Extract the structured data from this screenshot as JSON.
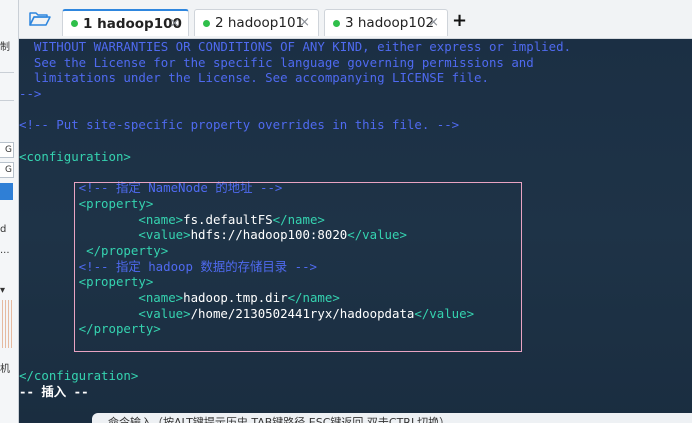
{
  "app": {
    "accent": "#2e86de",
    "terminal_bg": "#1b2f44"
  },
  "left_panel": {
    "frag_top": "制",
    "frag_g1": "G",
    "frag_g2": "G",
    "frag_d": "d",
    "frag_dots": "...",
    "frag_arrow": "▾",
    "frag_ji": "机"
  },
  "toolbar": {
    "folder_icon": "folder-open-icon"
  },
  "tabs": [
    {
      "label": "1  hadoop100",
      "status_color": "#2fbf4a",
      "close": "×",
      "active": true
    },
    {
      "label": "2  hadoop101",
      "status_color": "#2fbf4a",
      "close": "×",
      "active": false
    },
    {
      "label": "3  hadoop102",
      "status_color": "#2fbf4a",
      "close": "×",
      "active": false
    }
  ],
  "new_tab_label": "+",
  "terminal": {
    "lines": [
      [
        {
          "c": "c-blue",
          "t": "  WITHOUT WARRANTIES OR CONDITIONS OF ANY KIND, either express or implied."
        }
      ],
      [
        {
          "c": "c-blue",
          "t": "  See the License for the specific language governing permissions and"
        }
      ],
      [
        {
          "c": "c-blue",
          "t": "  limitations under the License. See accompanying LICENSE file."
        }
      ],
      [
        {
          "c": "c-blue",
          "t": "-->"
        }
      ],
      [],
      [
        {
          "c": "c-blue",
          "t": "<!-- Put site-specific property overrides in this file. -->"
        }
      ],
      [],
      [
        {
          "c": "c-green",
          "t": "<configuration>"
        }
      ],
      [],
      [
        {
          "c": "c-blue",
          "t": "        <!-- 指定 NameNode 的地址 -->"
        }
      ],
      [
        {
          "c": "c-green",
          "t": "        <property>"
        }
      ],
      [
        {
          "c": "c-white",
          "t": "                "
        },
        {
          "c": "c-green",
          "t": "<name>"
        },
        {
          "c": "c-white",
          "t": "fs.defaultFS"
        },
        {
          "c": "c-green",
          "t": "</name>"
        }
      ],
      [
        {
          "c": "c-white",
          "t": "                "
        },
        {
          "c": "c-green",
          "t": "<value>"
        },
        {
          "c": "c-white",
          "t": "hdfs://hadoop100:8020"
        },
        {
          "c": "c-green",
          "t": "</value>"
        }
      ],
      [
        {
          "c": "c-green",
          "t": "         </property>"
        }
      ],
      [
        {
          "c": "c-blue",
          "t": "        <!-- 指定 hadoop 数据的存储目录 -->"
        }
      ],
      [
        {
          "c": "c-green",
          "t": "        <property>"
        }
      ],
      [
        {
          "c": "c-white",
          "t": "                "
        },
        {
          "c": "c-green",
          "t": "<name>"
        },
        {
          "c": "c-white",
          "t": "hadoop.tmp.dir"
        },
        {
          "c": "c-green",
          "t": "</name>"
        }
      ],
      [
        {
          "c": "c-white",
          "t": "                "
        },
        {
          "c": "c-green",
          "t": "<value>"
        },
        {
          "c": "c-white",
          "t": "/home/2130502441ryx/hadoopdata"
        },
        {
          "c": "c-green",
          "t": "</value>"
        }
      ],
      [
        {
          "c": "c-green",
          "t": "        </property>"
        }
      ],
      [],
      [],
      [
        {
          "c": "c-green",
          "t": "</configuration>"
        }
      ],
      [
        {
          "c": "c-bold",
          "t": "-- 插入 --"
        }
      ]
    ]
  },
  "command_bar": {
    "text": "命令输入（按ALT键提示历史,TAB键路径,ESC键返回,双击CTRL切换）"
  }
}
